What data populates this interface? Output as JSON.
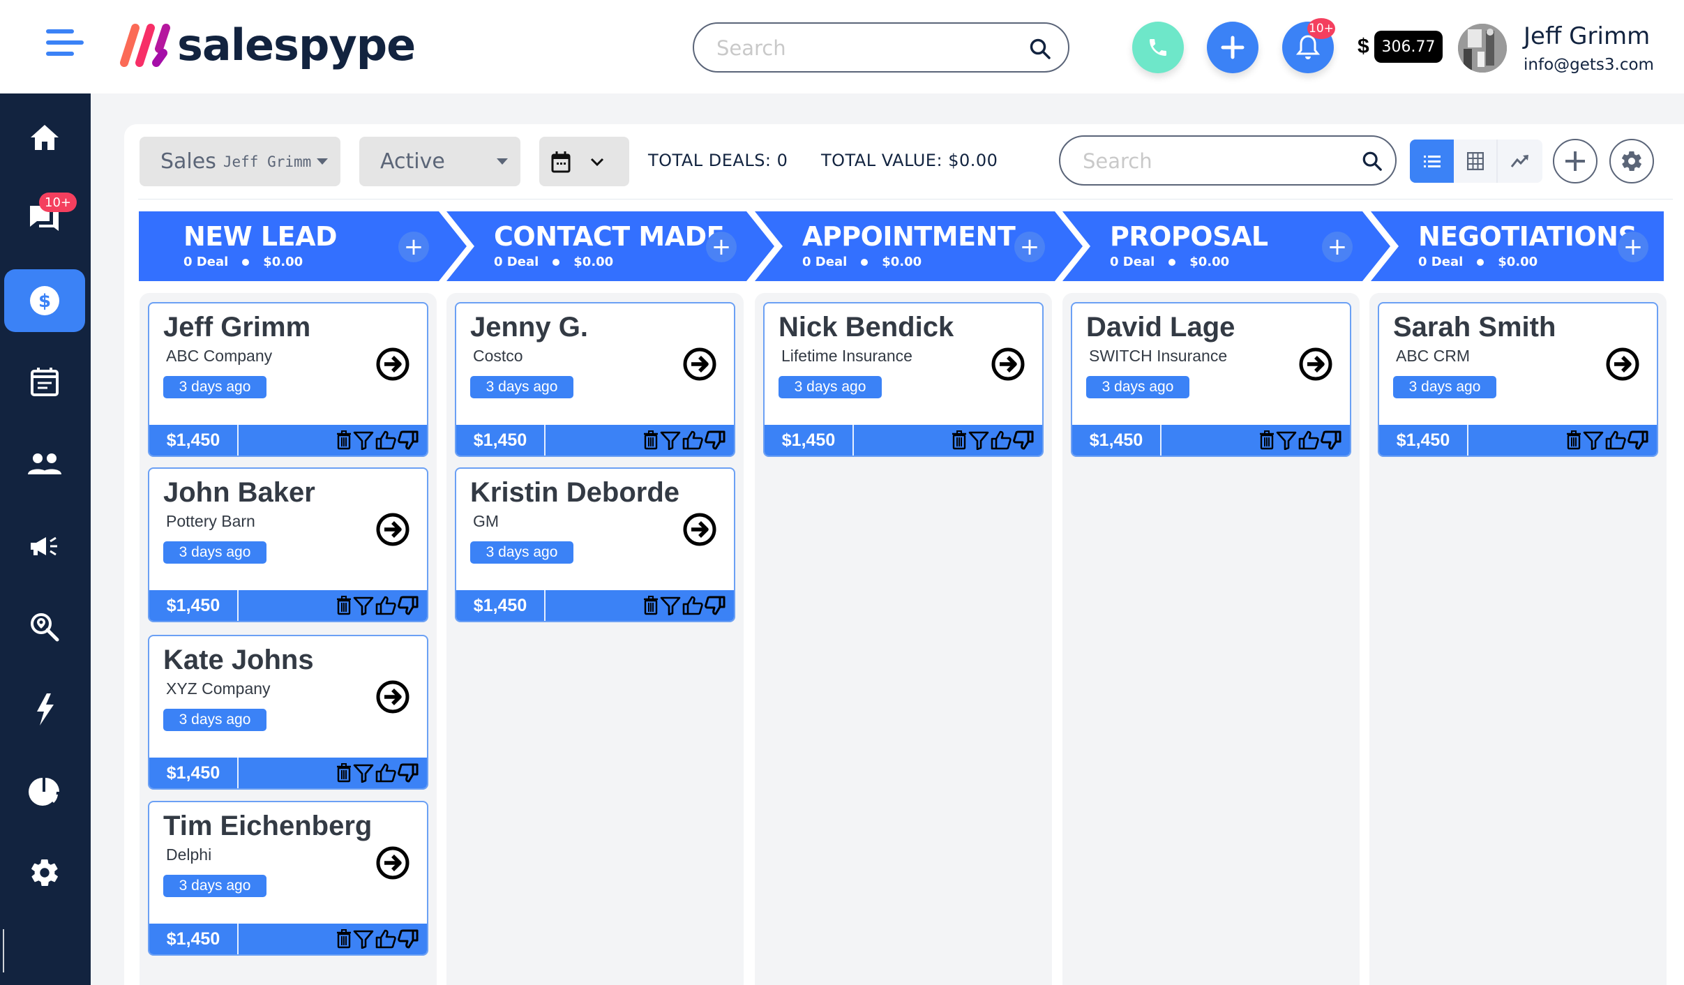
{
  "header": {
    "brand": "salespype",
    "search_placeholder": "Search",
    "notifications_badge": "10+",
    "balance_currency": "$",
    "balance_amount": "306.77",
    "user_name": "Jeff Grimm",
    "user_email": "info@gets3.com",
    "colors": {
      "accent": "#3b82f6",
      "call": "#6ee7c9",
      "badge": "#f43f5e",
      "sidebar": "#12233f"
    }
  },
  "sidebar": {
    "items": [
      {
        "name": "home",
        "icon": "home-icon"
      },
      {
        "name": "messages",
        "icon": "chat-icon",
        "badge": "10+"
      },
      {
        "name": "deals",
        "icon": "dollar-icon",
        "active": true
      },
      {
        "name": "calendar",
        "icon": "calendar-icon"
      },
      {
        "name": "contacts",
        "icon": "people-icon"
      },
      {
        "name": "campaigns",
        "icon": "megaphone-icon"
      },
      {
        "name": "lead-search",
        "icon": "location-search-icon"
      },
      {
        "name": "automation",
        "icon": "bolt-icon"
      },
      {
        "name": "reports",
        "icon": "pie-chart-icon"
      },
      {
        "name": "settings",
        "icon": "gear-icon"
      }
    ]
  },
  "toolbar": {
    "pipeline_label": "Sales",
    "pipeline_owner": "Jeff Grimm",
    "status_value": "Active",
    "total_deals": "TOTAL DEALS: 0",
    "total_value": "TOTAL VALUE: $0.00",
    "search_placeholder": "Search",
    "view_modes": [
      "list",
      "grid",
      "chart"
    ],
    "active_view": "list"
  },
  "stages": [
    {
      "title": "NEW LEAD",
      "deals": "0 Deal",
      "value": "$0.00",
      "cards": [
        {
          "name": "Jeff Grimm",
          "company": "ABC Company",
          "age": "3 days ago",
          "amount": "$1,450"
        },
        {
          "name": "John Baker",
          "company": "Pottery Barn",
          "age": "3 days ago",
          "amount": "$1,450"
        },
        {
          "name": "Kate Johns",
          "company": "XYZ Company",
          "age": "3 days ago",
          "amount": "$1,450"
        },
        {
          "name": "Tim Eichenberg",
          "company": "Delphi",
          "age": "3 days ago",
          "amount": "$1,450"
        }
      ]
    },
    {
      "title": "CONTACT MADE",
      "deals": "0 Deal",
      "value": "$0.00",
      "cards": [
        {
          "name": "Jenny G.",
          "company": "Costco",
          "age": "3 days ago",
          "amount": "$1,450"
        },
        {
          "name": "Kristin Deborde",
          "company": "GM",
          "age": "3 days ago",
          "amount": "$1,450"
        }
      ]
    },
    {
      "title": "APPOINTMENT",
      "deals": "0 Deal",
      "value": "$0.00",
      "cards": [
        {
          "name": "Nick Bendick",
          "company": "Lifetime Insurance",
          "age": "3 days ago",
          "amount": "$1,450"
        }
      ]
    },
    {
      "title": "PROPOSAL",
      "deals": "0 Deal",
      "value": "$0.00",
      "cards": [
        {
          "name": "David Lage",
          "company": "SWITCH Insurance",
          "age": "3 days ago",
          "amount": "$1,450"
        }
      ]
    },
    {
      "title": "NEGOTIATIONS",
      "deals": "0 Deal",
      "value": "$0.00",
      "cards": [
        {
          "name": "Sarah Smith",
          "company": "ABC CRM",
          "age": "3 days ago",
          "amount": "$1,450"
        }
      ]
    }
  ],
  "card_actions": [
    "delete",
    "filter",
    "thumbs-up",
    "thumbs-down"
  ]
}
